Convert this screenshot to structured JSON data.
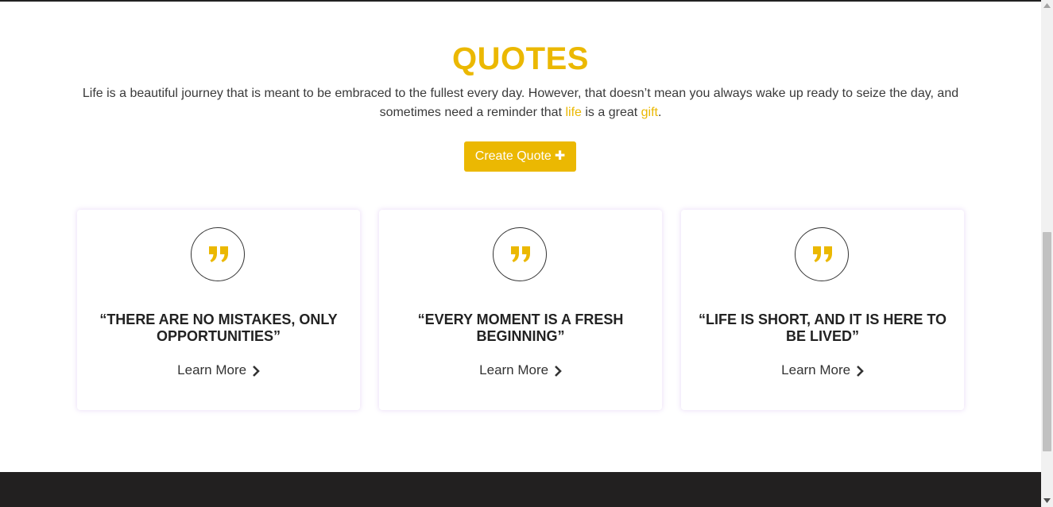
{
  "header": {
    "title": "QUOTES",
    "intro_part1": "Life is a beautiful journey that is meant to be embraced to the fullest every day. However, that doesn’t mean you always wake up ready to seize the day, and sometimes need a reminder that ",
    "intro_highlight1": "life",
    "intro_part2": " is a great ",
    "intro_highlight2": "gift",
    "intro_part3": "."
  },
  "actions": {
    "create_label": "Create Quote",
    "create_icon": "plus-icon"
  },
  "cards": [
    {
      "quote": "“THERE ARE NO MISTAKES, ONLY OPPORTUNITIES”",
      "link_label": "Learn More"
    },
    {
      "quote": "“EVERY MOMENT IS A FRESH BEGINNING”",
      "link_label": "Learn More"
    },
    {
      "quote": "“LIFE IS SHORT, AND IT IS HERE TO BE LIVED”",
      "link_label": "Learn More"
    }
  ],
  "icons": {
    "card_icon": "quote-mark-icon",
    "link_icon": "chevron-right-icon"
  },
  "colors": {
    "accent": "#ebb802",
    "text": "#3a3a3a",
    "heading_text": "#222222",
    "footer_bg": "#222020"
  }
}
